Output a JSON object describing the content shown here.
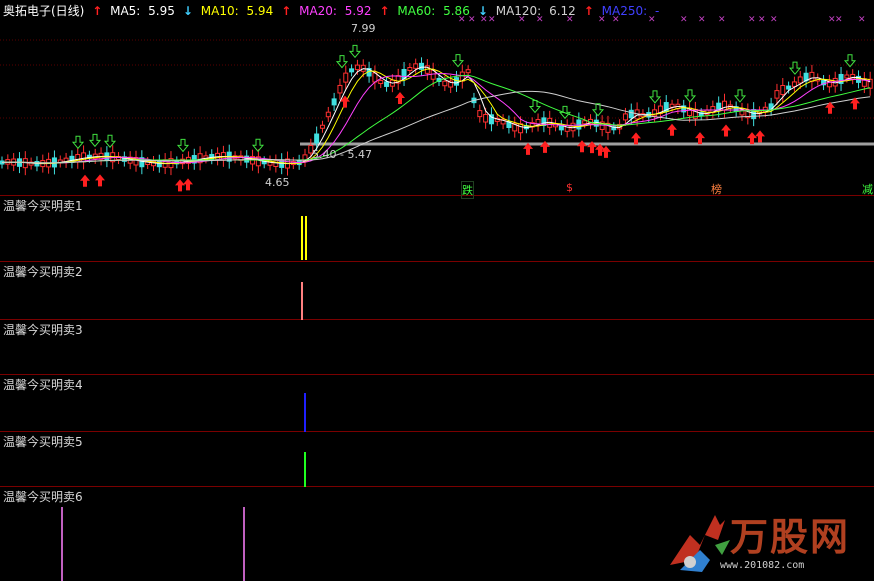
{
  "main_chart": {
    "title": "奥拓电子(日线)",
    "ma": [
      {
        "label": "MA5:",
        "value": "5.95",
        "trend": "down",
        "color": "#ffffff"
      },
      {
        "label": "MA10:",
        "value": "5.94",
        "trend": "up",
        "color": "#ffff00"
      },
      {
        "label": "MA20:",
        "value": "5.92",
        "trend": "up",
        "color": "#ff40ff"
      },
      {
        "label": "MA60:",
        "value": "5.86",
        "trend": "down",
        "color": "#40ff40"
      },
      {
        "label": "MA120:",
        "value": "6.12",
        "trend": "up",
        "color": "#d0d0d0"
      },
      {
        "label": "MA250:",
        "value": "-",
        "trend": "",
        "color": "#4040ff"
      }
    ],
    "high_label": "7.99",
    "low_label": "4.65",
    "range_label": "5.40 - 5.47",
    "tags": [
      {
        "text": "跌",
        "color": "#40ff40"
      },
      {
        "text": "$",
        "color": "#ff3030"
      },
      {
        "text": "榜",
        "color": "#ff8040"
      },
      {
        "text": "减",
        "color": "#40ff40"
      }
    ]
  },
  "indicators": [
    {
      "title": "温馨今买明卖1",
      "color": "#ffff00",
      "signal": "yellow-bar"
    },
    {
      "title": "温馨今买明卖2",
      "color": "#ff8080",
      "signal": "pink-bar"
    },
    {
      "title": "温馨今买明卖3",
      "color": "",
      "signal": ""
    },
    {
      "title": "温馨今买明卖4",
      "color": "#2020ff",
      "signal": "blue-bar"
    },
    {
      "title": "温馨今买明卖5",
      "color": "#20ff20",
      "signal": "green-bar"
    },
    {
      "title": "温馨今买明卖6",
      "color": "#c060c0",
      "signal": "purple-bars"
    }
  ],
  "watermark": {
    "text": "万股网",
    "url": "www.201082.com"
  },
  "icons": {
    "up": "up-arrow-icon",
    "down": "down-arrow-icon"
  }
}
